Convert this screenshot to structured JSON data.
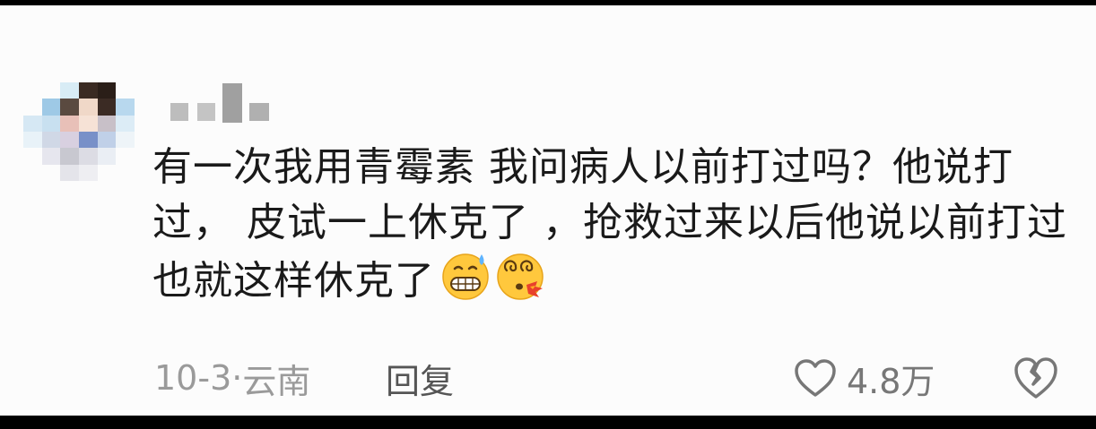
{
  "comment": {
    "text": "有一次我用青霉素 我问病人以前打过吗？他说打过， 皮试一上休克了 ，抢救过来以后他说以前打过也就这样休克了",
    "emojis": [
      "grimacing-sweat-emoji",
      "dizzy-blow-emoji"
    ]
  },
  "meta": {
    "date": "10-3",
    "separator": "·",
    "location": "云南",
    "reply_label": "回复"
  },
  "actions": {
    "like_count": "4.8万",
    "like_icon": "heart-outline-icon",
    "dislike_icon": "broken-heart-icon"
  },
  "colors": {
    "background": "#fcfcfc",
    "text": "#1a1a1a",
    "meta_text": "#9a9a9a",
    "icon": "#777777"
  }
}
